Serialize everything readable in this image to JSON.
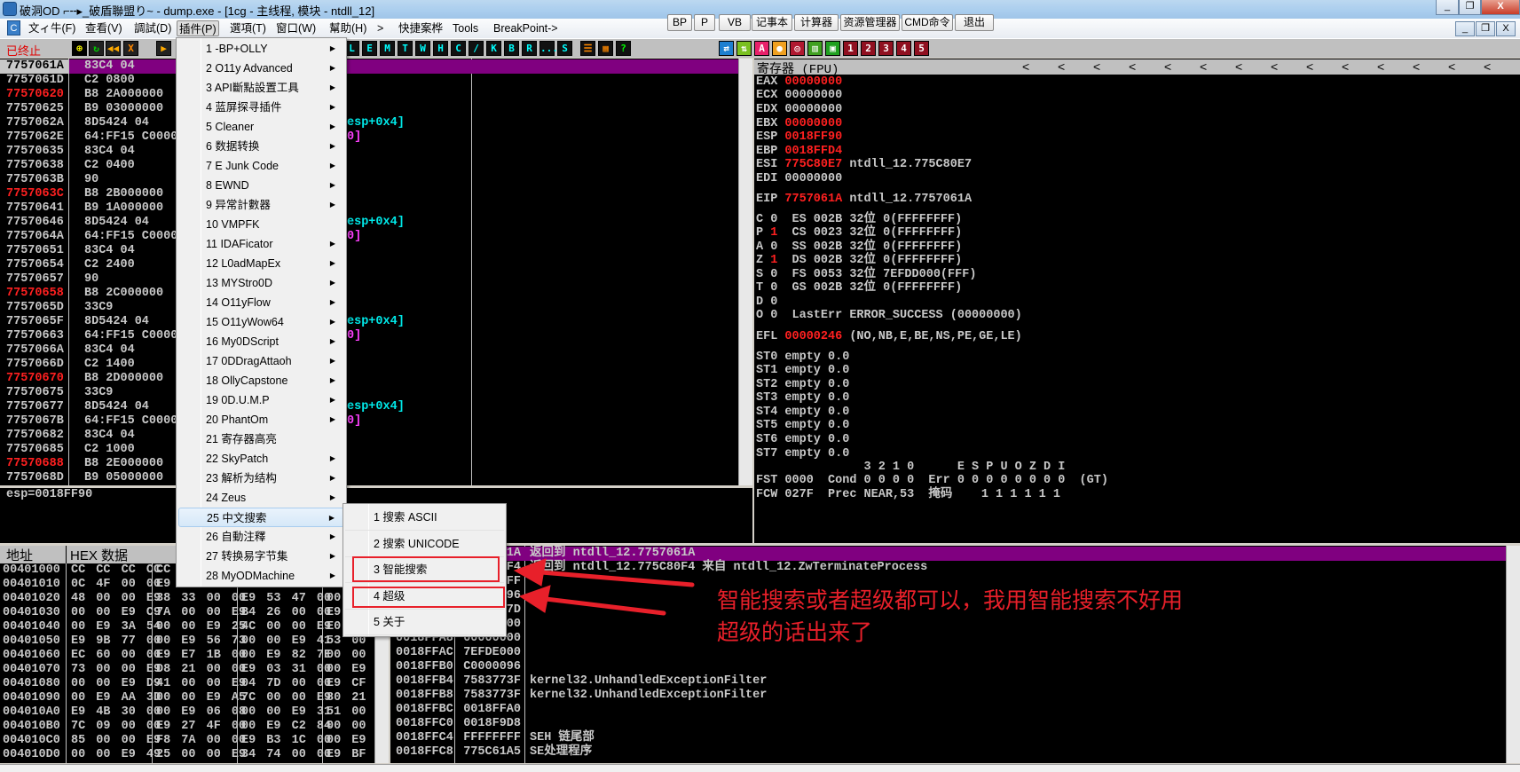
{
  "window": {
    "title": "破洞OD ⌐╌▸_破盾聯盟り~ - dump.exe - [1cg - 主线程, 模块 - ntdll_12]",
    "controls": [
      "_",
      "❐",
      "X"
    ],
    "mdi_controls": [
      "_",
      "❐",
      "X"
    ]
  },
  "menubar": {
    "items": [
      "文ィ牛(F)",
      "查看(V)",
      "調試(D)",
      "插件(P)",
      "選項(T)",
      "窗口(W)",
      "幫助(H)",
      ">",
      "快捷案桦",
      "Tools",
      "BreakPoint->"
    ],
    "buttons": [
      "BP",
      "P",
      "VB",
      "记事本",
      "计算器",
      "资源管理器",
      "CMD命令",
      "退出"
    ]
  },
  "toolbar": {
    "status": "已终止",
    "left_icons": [
      {
        "name": "open-icon",
        "g": "⊕"
      },
      {
        "name": "restart-icon",
        "g": "↻"
      },
      {
        "name": "rewind-icon",
        "g": "◀◀"
      },
      {
        "name": "close-icon",
        "g": "X"
      },
      {
        "name": "run-icon",
        "g": "▶"
      }
    ],
    "letter_buttons": [
      "L",
      "E",
      "M",
      "T",
      "W",
      "H",
      "C",
      "/",
      "K",
      "B",
      "R",
      "...",
      "S"
    ],
    "grid_icons": [
      {
        "name": "list-icon",
        "g": "☰"
      },
      {
        "name": "grid-icon",
        "g": "▦"
      },
      {
        "name": "help-icon",
        "g": "?"
      }
    ],
    "right_icons": [
      {
        "name": "swap-icon",
        "g": "⇄",
        "bg": "#1e7fd0"
      },
      {
        "name": "pause-icon",
        "g": "⇅",
        "bg": "#7ac020"
      },
      {
        "name": "ascii-icon",
        "g": "A",
        "bg": "#e8206a"
      },
      {
        "name": "record-icon",
        "g": "●",
        "bg": "#f0a020"
      },
      {
        "name": "target-icon",
        "g": "◎",
        "bg": "#b01830"
      },
      {
        "name": "binary-icon",
        "g": "▥",
        "bg": "#40a020"
      },
      {
        "name": "window-icon",
        "g": "▣",
        "bg": "#20a020"
      },
      {
        "name": "slot-1-icon",
        "g": "1",
        "bg": "#901020"
      },
      {
        "name": "slot-2-icon",
        "g": "2",
        "bg": "#901020"
      },
      {
        "name": "slot-3-icon",
        "g": "3",
        "bg": "#901020"
      },
      {
        "name": "slot-4-icon",
        "g": "4",
        "bg": "#901020"
      },
      {
        "name": "slot-5-icon",
        "g": "5",
        "bg": "#901020"
      }
    ]
  },
  "disasm": {
    "rows": [
      {
        "a": "7757061A",
        "h": "83C4 04",
        "sel": true
      },
      {
        "a": "7757061D",
        "h": "C2 0800"
      },
      {
        "a": "77570620",
        "h": "B8 2A000000",
        "red": true
      },
      {
        "a": "77570625",
        "h": "B9 03000000"
      },
      {
        "a": "7757062A",
        "h": "8D5424 04",
        "cm": "esp+0x4]",
        "cc": "c"
      },
      {
        "a": "7757062E",
        "h": "64:FF15 C0000",
        "cm": "0]",
        "cc": "m"
      },
      {
        "a": "77570635",
        "h": "83C4 04"
      },
      {
        "a": "77570638",
        "h": "C2 0400"
      },
      {
        "a": "7757063B",
        "h": "90"
      },
      {
        "a": "7757063C",
        "h": "B8 2B000000",
        "red": true
      },
      {
        "a": "77570641",
        "h": "B9 1A000000"
      },
      {
        "a": "77570646",
        "h": "8D5424 04",
        "cm": "esp+0x4]",
        "cc": "c"
      },
      {
        "a": "7757064A",
        "h": "64:FF15 C0000",
        "cm": "0]",
        "cc": "m"
      },
      {
        "a": "77570651",
        "h": "83C4 04"
      },
      {
        "a": "77570654",
        "h": "C2 2400"
      },
      {
        "a": "77570657",
        "h": "90"
      },
      {
        "a": "77570658",
        "h": "B8 2C000000",
        "red": true
      },
      {
        "a": "7757065D",
        "h": "33C9"
      },
      {
        "a": "7757065F",
        "h": "8D5424 04",
        "cm": "esp+0x4]",
        "cc": "c"
      },
      {
        "a": "77570663",
        "h": "64:FF15 C0000",
        "cm": "0]",
        "cc": "m"
      },
      {
        "a": "7757066A",
        "h": "83C4 04"
      },
      {
        "a": "7757066D",
        "h": "C2 1400"
      },
      {
        "a": "77570670",
        "h": "B8 2D000000",
        "red": true
      },
      {
        "a": "77570675",
        "h": "33C9"
      },
      {
        "a": "77570677",
        "h": "8D5424 04",
        "cm": "esp+0x4]",
        "cc": "c"
      },
      {
        "a": "7757067B",
        "h": "64:FF15 C0000",
        "cm": "0]",
        "cc": "m"
      },
      {
        "a": "77570682",
        "h": "83C4 04"
      },
      {
        "a": "77570685",
        "h": "C2 1000"
      },
      {
        "a": "77570688",
        "h": "B8 2E000000",
        "red": true
      },
      {
        "a": "7757068D",
        "h": "B9 05000000"
      }
    ]
  },
  "info": {
    "text": "esp=0018FF90"
  },
  "registers": {
    "title": "寄存器 (FPU)",
    "lines": [
      [
        {
          "t": "EAX "
        },
        {
          "t": "00000000",
          "r": 1
        }
      ],
      [
        {
          "t": "ECX 00000000"
        }
      ],
      [
        {
          "t": "EDX 00000000"
        }
      ],
      [
        {
          "t": "EBX "
        },
        {
          "t": "00000000",
          "r": 1
        }
      ],
      [
        {
          "t": "ESP "
        },
        {
          "t": "0018FF90",
          "r": 1
        }
      ],
      [
        {
          "t": "EBP "
        },
        {
          "t": "0018FFD4",
          "r": 1
        }
      ],
      [
        {
          "t": "ESI "
        },
        {
          "t": "775C80E7",
          "r": 1
        },
        {
          "t": " ntdll_12.775C80E7"
        }
      ],
      [
        {
          "t": "EDI 00000000"
        }
      ],
      [
        {
          "t": "EIP "
        },
        {
          "t": "7757061A",
          "r": 1
        },
        {
          "t": " ntdll_12.7757061A"
        }
      ],
      [
        {
          "t": "C 0  ES 002B 32位 0(FFFFFFFF)"
        }
      ],
      [
        {
          "t": "P "
        },
        {
          "t": "1",
          "r": 1
        },
        {
          "t": "  CS 0023 32位 0(FFFFFFFF)"
        }
      ],
      [
        {
          "t": "A 0  SS 002B 32位 0(FFFFFFFF)"
        }
      ],
      [
        {
          "t": "Z "
        },
        {
          "t": "1",
          "r": 1
        },
        {
          "t": "  DS 002B 32位 0(FFFFFFFF)"
        }
      ],
      [
        {
          "t": "S 0  FS 0053 32位 7EFDD000(FFF)"
        }
      ],
      [
        {
          "t": "T 0  GS 002B 32位 0(FFFFFFFF)"
        }
      ],
      [
        {
          "t": "D 0"
        }
      ],
      [
        {
          "t": "O 0  LastErr ERROR_SUCCESS (00000000)"
        }
      ],
      [
        {
          "t": "EFL "
        },
        {
          "t": "00000246",
          "r": 1
        },
        {
          "t": " (NO,NB,E,BE,NS,PE,GE,LE)"
        }
      ],
      [
        {
          "t": "ST0 empty 0.0"
        }
      ],
      [
        {
          "t": "ST1 empty 0.0"
        }
      ],
      [
        {
          "t": "ST2 empty 0.0"
        }
      ],
      [
        {
          "t": "ST3 empty 0.0"
        }
      ],
      [
        {
          "t": "ST4 empty 0.0"
        }
      ],
      [
        {
          "t": "ST5 empty 0.0"
        }
      ],
      [
        {
          "t": "ST6 empty 0.0"
        }
      ],
      [
        {
          "t": "ST7 empty 0.0"
        }
      ],
      [
        {
          "t": "               3 2 1 0      E S P U O Z D I"
        }
      ],
      [
        {
          "t": "FST 0000  Cond 0 0 0 0  Err 0 0 0 0 0 0 0 0  (GT)"
        }
      ],
      [
        {
          "t": "FCW 027F  Prec NEAR,53  掩码    1 1 1 1 1 1"
        }
      ]
    ]
  },
  "dump": {
    "headers": [
      "地址",
      "HEX 数据"
    ],
    "rows": [
      {
        "a": "00401000",
        "g": [
          "CC CC CC CC",
          "CC",
          "",
          ""
        ]
      },
      {
        "a": "00401010",
        "g": [
          "0C 4F 00 00",
          "E9",
          "",
          ""
        ]
      },
      {
        "a": "00401020",
        "g": [
          "48 00 00 E9",
          "38 33 00 00",
          "E9 53 47 00",
          "00"
        ]
      },
      {
        "a": "00401030",
        "g": [
          "00 00 E9 C9",
          "7A 00 00 E9",
          "B4 26 00 00",
          "E9"
        ]
      },
      {
        "a": "00401040",
        "g": [
          "00 E9 3A 54",
          "00 00 E9 25",
          "4C 00 00 E9",
          "E0"
        ]
      },
      {
        "a": "00401050",
        "g": [
          "E9 9B 77 00",
          "00 E9 56 73",
          "00 00 E9 41",
          "53 00 0"
        ]
      },
      {
        "a": "00401060",
        "g": [
          "EC 60 00 00",
          "E9 E7 1B 00",
          "00 E9 82 7E",
          "00 00 E"
        ]
      },
      {
        "a": "00401070",
        "g": [
          "73 00 00 E9",
          "D8 21 00 00",
          "E9 03 31 00",
          "00 E9 4"
        ]
      },
      {
        "a": "00401080",
        "g": [
          "00 00 E9 D9",
          "41 00 00 E9",
          "04 7D 00 00",
          "E9 CF 4"
        ]
      },
      {
        "a": "00401090",
        "g": [
          "00 E9 AA 3D",
          "00 00 E9 A5",
          "7C 00 00 E9",
          "80 21 0"
        ]
      },
      {
        "a": "004010A0",
        "g": [
          "E9 4B 30 00",
          "00 E9 06 08",
          "00 00 E9 31",
          "51 00 0"
        ]
      },
      {
        "a": "004010B0",
        "g": [
          "7C 09 00 00",
          "E9 27 4F 00",
          "00 E9 C2 84",
          "00 00 E"
        ]
      },
      {
        "a": "004010C0",
        "g": [
          "85 00 00 E9",
          "F8 7A 00 00",
          "E9 B3 1C 00",
          "00 E9 3"
        ]
      },
      {
        "a": "004010D0",
        "g": [
          "00 00 E9 49",
          "25 00 00 E9",
          "34 74 00 00",
          "E9 BF 1"
        ]
      }
    ]
  },
  "stack": {
    "rows": [
      {
        "a": "",
        "v": "1A",
        "c": "返回到 ntdll_12.7757061A",
        "sel": true
      },
      {
        "a": "",
        "v": "F4",
        "c": "返回到 ntdll_12.775C80F4 来自 ntdll_12.ZwTerminateProcess"
      },
      {
        "a": "",
        "v": "FF",
        "c": ""
      },
      {
        "a": "",
        "v": "96",
        "c": ""
      },
      {
        "a": "",
        "v": "7D",
        "c": ""
      },
      {
        "a": "",
        "v": "00",
        "c": ""
      },
      {
        "a": "0018FFA8",
        "v": "00000000",
        "c": ""
      },
      {
        "a": "0018FFAC",
        "v": "7EFDE000",
        "c": ""
      },
      {
        "a": "0018FFB0",
        "v": "C0000096",
        "c": ""
      },
      {
        "a": "0018FFB4",
        "v": "7583773F",
        "c": "kernel32.UnhandledExceptionFilter"
      },
      {
        "a": "0018FFB8",
        "v": "7583773F",
        "c": "kernel32.UnhandledExceptionFilter"
      },
      {
        "a": "0018FFBC",
        "v": "0018FFA0",
        "c": ""
      },
      {
        "a": "0018FFC0",
        "v": "0018F9D8",
        "c": ""
      },
      {
        "a": "0018FFC4",
        "v": "FFFFFFFF",
        "c": "SEH 链尾部"
      },
      {
        "a": "0018FFC8",
        "v": "775C61A5",
        "c": "SE处理程序"
      }
    ]
  },
  "plugin_menu": {
    "items": [
      {
        "l": "1 -BP+OLLY",
        "s": 1
      },
      {
        "l": "2 O11y Advanced",
        "s": 1
      },
      {
        "l": "3 API斷點設置工具",
        "s": 1
      },
      {
        "l": "4 蓝屏探寻插件",
        "s": 1
      },
      {
        "l": "5 Cleaner",
        "s": 1
      },
      {
        "l": "6 数据转换",
        "s": 1
      },
      {
        "l": "7 E Junk Code",
        "s": 1
      },
      {
        "l": "8 EWND",
        "s": 1
      },
      {
        "l": "9 异常計數器",
        "s": 1
      },
      {
        "l": "10 VMPFK",
        "s": 0
      },
      {
        "l": "11 IDAFicator",
        "s": 1
      },
      {
        "l": "12 L0adMapEx",
        "s": 1
      },
      {
        "l": "13 MYStro0D",
        "s": 1
      },
      {
        "l": "14 O11yFlow",
        "s": 1
      },
      {
        "l": "15 O11yWow64",
        "s": 1
      },
      {
        "l": "16 My0DScript",
        "s": 1
      },
      {
        "l": "17 0DDragAttaoh",
        "s": 1
      },
      {
        "l": "18 OllyCapstone",
        "s": 1
      },
      {
        "l": "19 0D.U.M.P",
        "s": 1
      },
      {
        "l": "20 PhantOm",
        "s": 1
      },
      {
        "l": "21 寄存器高亮",
        "s": 0
      },
      {
        "l": "22 SkyPatch",
        "s": 1
      },
      {
        "l": "23 解析为结构",
        "s": 1
      },
      {
        "l": "24 Zeus",
        "s": 1
      },
      {
        "l": "25 中文搜索",
        "s": 1,
        "hl": 1
      },
      {
        "l": "26 自動注釋",
        "s": 1
      },
      {
        "l": "27 转换易字节集",
        "s": 1
      },
      {
        "l": "28 MyODMachine",
        "s": 1
      }
    ]
  },
  "sub_menu": {
    "items": [
      "1 搜索 ASCII",
      "2 搜索 UNICODE",
      "3 智能搜索",
      "4 超级",
      "5 关于"
    ]
  },
  "annotation": {
    "line1": "智能搜索或者超级都可以，我用智能搜索不好用",
    "line2": "超级的话出来了",
    "color": "#e8202a"
  }
}
